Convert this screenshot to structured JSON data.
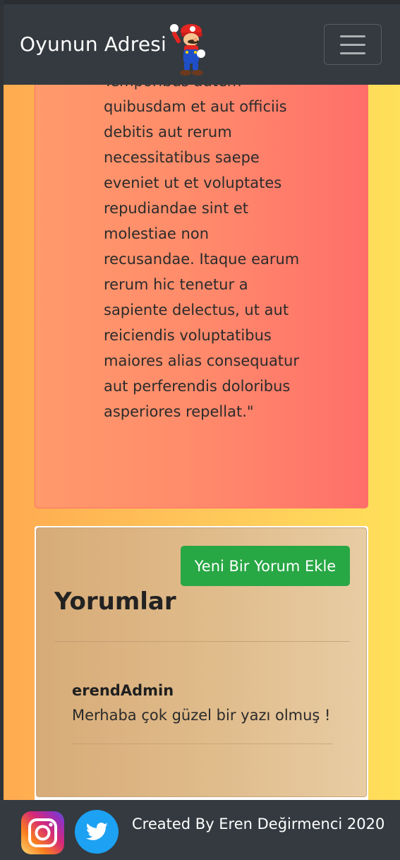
{
  "navbar": {
    "brand": "Oyunun Adresi",
    "logo_icon": "mario-icon",
    "menu_icon": "hamburger-menu-icon"
  },
  "article": {
    "body_text": "Temporibus autem\nquibusdam et aut officiis\ndebitis aut rerum\nnecessitatibus saepe\neveniet ut et voluptates\nrepudiandae sint et\nmolestiae non\nrecusandae. Itaque earum\nrerum hic tenetur a\nsapiente delectus, ut aut\nreiciendis voluptatibus\nmaiores alias consequatur\naut perferendis doloribus\nasperiores repellat.\""
  },
  "comments": {
    "add_button_label": "Yeni Bir Yorum Ekle",
    "title": "Yorumlar",
    "items": [
      {
        "author": "erendAdmin",
        "text": "Merhaba çok güzel bir yazı olmuş !"
      }
    ]
  },
  "footer": {
    "text": "Created By Eren Değirmenci  2020",
    "icons": [
      "instagram-icon",
      "twitter-icon"
    ]
  },
  "colors": {
    "navbar": "#343a40",
    "button_green": "#28a745",
    "article_card": "#ff7f6b",
    "comments_card": "#dfb989"
  }
}
